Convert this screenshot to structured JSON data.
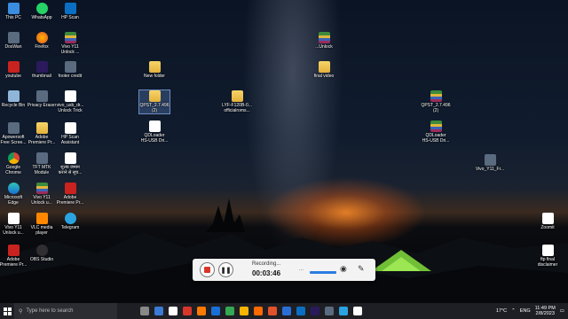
{
  "desktop": {
    "icons": [
      {
        "label": "This PC",
        "kind": "pc"
      },
      {
        "label": "WhatsApp",
        "kind": "whatsapp"
      },
      {
        "label": "HP Scan",
        "kind": "hpscan"
      },
      {
        "label": "DosWan",
        "kind": "app"
      },
      {
        "label": "Firefox",
        "kind": "firefox"
      },
      {
        "label": "Vivo Y11\nUnlock ...",
        "kind": "rar"
      },
      {
        "label": "youtube",
        "kind": "pdf"
      },
      {
        "label": "thumbnail",
        "kind": "premiere"
      },
      {
        "label": "footer credit",
        "kind": "app"
      },
      {
        "label": "Recycle Bin",
        "kind": "bin"
      },
      {
        "label": "Privacy Eraser",
        "kind": "app"
      },
      {
        "label": "vivo_usb_dr...\nUnlock Trick",
        "kind": "doc"
      },
      {
        "label": "Apowersoft\nFree Scree...",
        "kind": "app"
      },
      {
        "label": "Adobe\nPremiere Pr...",
        "kind": "folder"
      },
      {
        "label": "HP Scan\nAssistant",
        "kind": "doc"
      },
      {
        "label": "Google\nChrome",
        "kind": "chrome"
      },
      {
        "label": "TFT MTK\nModule",
        "kind": "app"
      },
      {
        "label": "शुल्क जमान\nकराने से सूच...",
        "kind": "doc"
      },
      {
        "label": "Microsoft\nEdge",
        "kind": "edge"
      },
      {
        "label": "Vivo Y11\nUnlock u...",
        "kind": "rar"
      },
      {
        "label": "Adobe\nPremiere Pr...",
        "kind": "pdf"
      },
      {
        "label": "Vivo Y11\nUnlock u...",
        "kind": "doc"
      },
      {
        "label": "VLC media\nplayer",
        "kind": "vlc"
      },
      {
        "label": "Telegram",
        "kind": "telegram"
      },
      {
        "label": "Adobe\nPremiere Pr...",
        "kind": "pdf"
      },
      {
        "label": "OBS Studio",
        "kind": "obs"
      },
      {
        "label": "New folder",
        "kind": "folder"
      },
      {
        "label": "QPST_2.7.496\n(2)",
        "kind": "folder"
      },
      {
        "label": "QDLoader\nHS-USB Dri...",
        "kind": "doc"
      },
      {
        "label": "LYF-F120B-0...\nofficialroms...",
        "kind": "folder"
      },
      {
        "label": "...Unlock",
        "kind": "rar"
      },
      {
        "label": "final video",
        "kind": "folder"
      },
      {
        "label": "QPST_2.7.496\n(2)",
        "kind": "rar"
      },
      {
        "label": "QDLoader\nHS-USB Dri...",
        "kind": "rar"
      },
      {
        "label": "Vivo_Y11_Fr...",
        "kind": "app"
      },
      {
        "label": "Zoomit",
        "kind": "doc"
      },
      {
        "label": "ftp final\ndisclaimer",
        "kind": "doc"
      }
    ]
  },
  "recorder": {
    "status": "Recording...",
    "time": "00:03:46",
    "dots": "...",
    "mic_icon": "mic-icon",
    "pen_icon": "pen-icon"
  },
  "taskbar": {
    "search_placeholder": "Type here to search",
    "temperature": "17°C",
    "language": "ENG",
    "time": "11:49 PM",
    "date": "2/8/2023"
  },
  "colors": {
    "taskbar": "#1e1f24",
    "recorder_bg": "#f3f3f3",
    "stop_red": "#d9362b"
  }
}
